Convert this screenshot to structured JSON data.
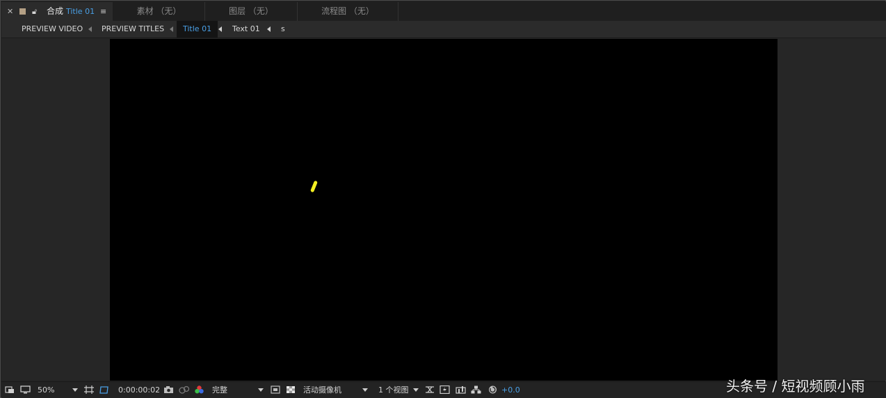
{
  "panel_tabs": {
    "active": {
      "prefix": "合成",
      "comp_name": "Title 01"
    },
    "inactive": [
      "素材 （无）",
      "图层 （无）",
      "流程图 （无）"
    ]
  },
  "breadcrumbs": [
    "PREVIEW VIDEO",
    "PREVIEW TITLES",
    "Title 01",
    "Text 01",
    "s"
  ],
  "toolbar": {
    "zoom": "50%",
    "timecode": "0:00:00:02",
    "resolution": "完整",
    "camera": "活动摄像机",
    "views": "1 个视图",
    "exposure": "+0.0"
  },
  "colors": {
    "accent": "#4aa0e6",
    "canvas": "#000000",
    "stroke": "#f3ef21"
  },
  "watermark": "头条号 / 短视频顾小雨"
}
